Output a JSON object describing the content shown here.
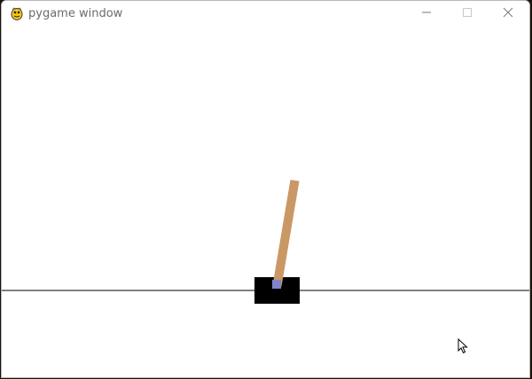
{
  "window": {
    "title": "pygame window",
    "controls": [
      "minimize",
      "maximize",
      "close"
    ]
  },
  "icons": {
    "app": "pygame-snake-icon",
    "minimize": "minimize-icon",
    "maximize": "maximize-icon",
    "close": "close-icon",
    "cursor": "mouse-pointer-icon"
  },
  "colors": {
    "cart": "#000000",
    "pole": "#ca9865",
    "axle": "#8184cb",
    "track": "#000000",
    "background": "#ffffff"
  }
}
